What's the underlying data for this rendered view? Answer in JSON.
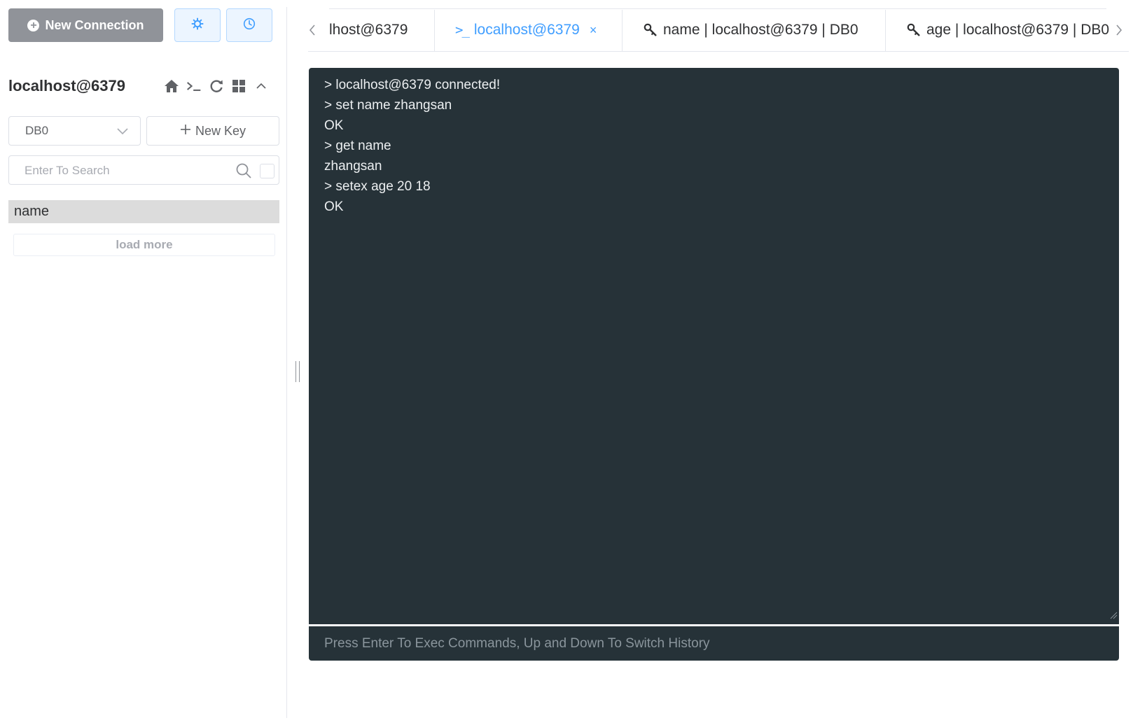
{
  "sidebar": {
    "new_connection_label": "New Connection",
    "connection_title": "localhost@6379",
    "db_select_value": "DB0",
    "new_key_label": "New Key",
    "search_placeholder": "Enter To Search",
    "keys": [
      "name"
    ],
    "load_more_label": "load more"
  },
  "tabs": [
    {
      "label": "lhost@6379",
      "icon": "",
      "active": false
    },
    {
      "label": "localhost@6379",
      "icon": "terminal-icon",
      "active": true
    },
    {
      "label": "name | localhost@6379 | DB0",
      "icon": "key-icon",
      "active": false
    },
    {
      "label": "age | localhost@6379 | DB0",
      "icon": "key-icon",
      "active": false
    }
  ],
  "tab_terminal_glyph": ">_",
  "tab_close_glyph": "×",
  "console": {
    "lines": [
      "> localhost@6379 connected!",
      "> set name zhangsan",
      "OK",
      "> get name",
      "zhangsan",
      "> setex age 20 18",
      "OK"
    ],
    "input_placeholder": "Press Enter To Exec Commands, Up and Down To Switch History"
  },
  "colors": {
    "accent": "#409eff",
    "console_bg": "#263238",
    "new_connection_bg": "#909399",
    "selected_key_bg": "#dcdcdc"
  }
}
